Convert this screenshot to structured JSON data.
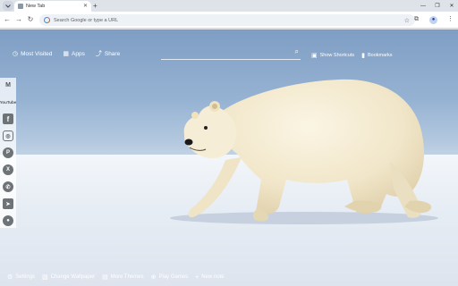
{
  "browser": {
    "tab": {
      "title": "New Tab"
    },
    "new_tab_symbol": "+",
    "address_placeholder": "Search Google or type a URL"
  },
  "page": {
    "topbar": [
      {
        "icon": "history-icon",
        "label": "Most Visited"
      },
      {
        "icon": "apps-icon",
        "label": "Apps"
      },
      {
        "icon": "share-icon",
        "label": "Share"
      }
    ],
    "right_links": [
      {
        "icon": "shortcuts-icon",
        "label": "Show Shortcuts"
      },
      {
        "icon": "bookmark-icon",
        "label": "Bookmarks"
      }
    ],
    "social": [
      "gmail-icon",
      "youtube-icon",
      "facebook-icon",
      "instagram-icon",
      "pinterest-icon",
      "x-icon",
      "whatsapp-icon",
      "telegram-icon",
      "reddit-icon"
    ],
    "bottombar": [
      {
        "icon": "settings-icon",
        "label": "Settings"
      },
      {
        "icon": "wallpaper-icon",
        "label": "Change Wallpaper"
      },
      {
        "icon": "themes-icon",
        "label": "More Themes"
      },
      {
        "icon": "games-icon",
        "label": "Play Games"
      },
      {
        "icon": "plus-icon",
        "label": "New note"
      }
    ]
  }
}
